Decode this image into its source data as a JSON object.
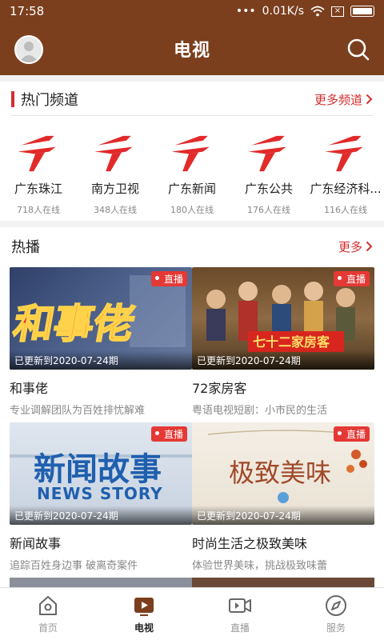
{
  "status": {
    "time": "17:58",
    "dots": "•••",
    "speed": "0.01K/s"
  },
  "app": {
    "title": "电视"
  },
  "hot_channels": {
    "title": "热门频道",
    "more": "更多频道",
    "items": [
      {
        "name": "广东珠江",
        "online": "718人在线"
      },
      {
        "name": "南方卫视",
        "online": "348人在线"
      },
      {
        "name": "广东新闻",
        "online": "180人在线"
      },
      {
        "name": "广东公共",
        "online": "176人在线"
      },
      {
        "name": "广东经济科...",
        "online": "116人在线"
      }
    ]
  },
  "hot_shows": {
    "title": "热播",
    "more": "更多",
    "items": [
      {
        "title": "和事佬",
        "desc": "专业调解团队为百姓排忧解难",
        "live": "直播",
        "updated": "已更新到2020-07-24期",
        "thumb_text": "和事佬"
      },
      {
        "title": "72家房客",
        "desc": "粤语电视短剧：小市民的生活",
        "live": "直播",
        "updated": "已更新到2020-07-24期",
        "thumb_text": "七十二家房客"
      },
      {
        "title": "新闻故事",
        "desc": "追踪百姓身边事 破离奇案件",
        "live": "直播",
        "updated": "已更新到2020-07-24期",
        "thumb_text": "新闻故事",
        "thumb_sub": "NEWS STORY"
      },
      {
        "title": "时尚生活之极致美味",
        "desc": "体验世界美味，挑战极致味蕾",
        "live": "直播",
        "updated": "已更新到2020-07-24期",
        "thumb_text": "极致美味"
      }
    ]
  },
  "tabs": [
    {
      "label": "首页",
      "icon": "home-icon"
    },
    {
      "label": "电视",
      "icon": "tv-play-icon",
      "active": true
    },
    {
      "label": "直播",
      "icon": "video-camera-icon"
    },
    {
      "label": "服务",
      "icon": "compass-icon"
    }
  ],
  "colors": {
    "brand": "#7b3f1e",
    "accent": "#d32f2f",
    "live": "#e53935"
  }
}
